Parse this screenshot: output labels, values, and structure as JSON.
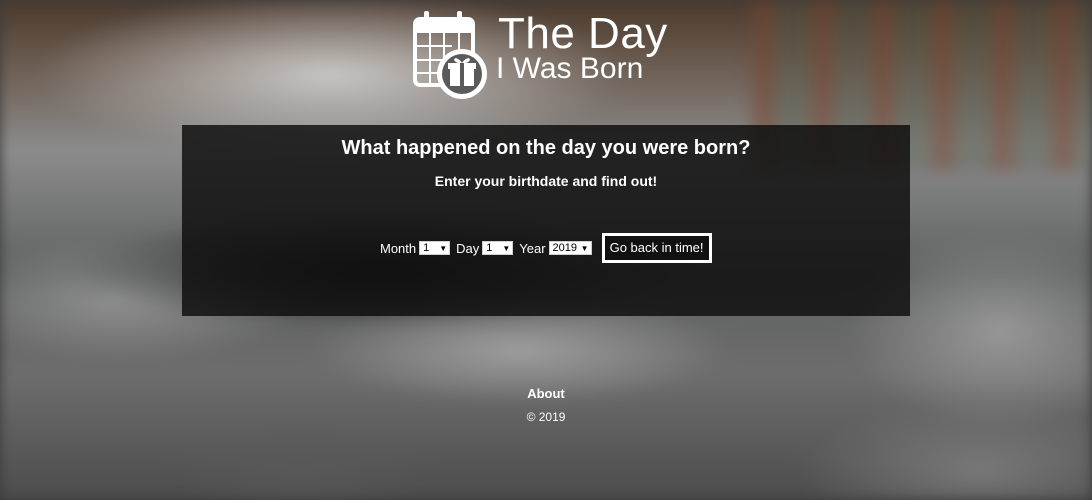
{
  "logo": {
    "line1": "The Day",
    "line2": "I Was Born",
    "icon": "calendar-gift-icon",
    "color": "#ffffff"
  },
  "panel": {
    "title": "What happened on the day you were born?",
    "subtitle": "Enter your birthdate and find out!",
    "background": "#0c0c0c"
  },
  "form": {
    "month_label": "Month",
    "month_value": "1",
    "day_label": "Day",
    "day_value": "1",
    "year_label": "Year",
    "year_value": "2019",
    "submit_label": "Go back in time!"
  },
  "footer": {
    "about": "About",
    "copyright": "© 2019"
  }
}
